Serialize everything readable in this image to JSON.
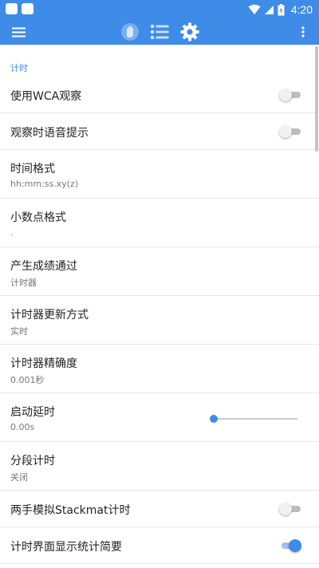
{
  "status_bar": {
    "time": "4:20",
    "icons": [
      "notification-square-icon",
      "notification-square-icon",
      "wifi-icon",
      "signal-icon",
      "battery-icon"
    ]
  },
  "app_bar": {
    "icons": [
      "menu-icon",
      "timer-hand-icon",
      "list-icon",
      "gear-icon",
      "more-vert-icon"
    ],
    "color": "#3f8be8"
  },
  "section": {
    "title": "计时"
  },
  "settings": {
    "use_wca_inspection": {
      "title": "使用WCA观察",
      "on": false
    },
    "inspection_voice": {
      "title": "观察时语音提示",
      "on": false
    },
    "time_format": {
      "title": "时间格式",
      "summary": "hh:mm:ss.xy(z)"
    },
    "decimal_format": {
      "title": "小数点格式",
      "summary": "."
    },
    "result_source": {
      "title": "产生成绩通过",
      "summary": "计时器"
    },
    "timer_update": {
      "title": "计时器更新方式",
      "summary": "实时"
    },
    "timer_precision": {
      "title": "计时器精确度",
      "summary": "0.001秒"
    },
    "start_delay": {
      "title": "启动延时",
      "summary": "0.00s",
      "slider_value": 0
    },
    "split_timing": {
      "title": "分段计时",
      "summary": "关闭"
    },
    "stackmat_sim": {
      "title": "两手模拟Stackmat计时",
      "on": false
    },
    "show_stats": {
      "title": "计时界面显示统计简要",
      "on": true
    }
  }
}
